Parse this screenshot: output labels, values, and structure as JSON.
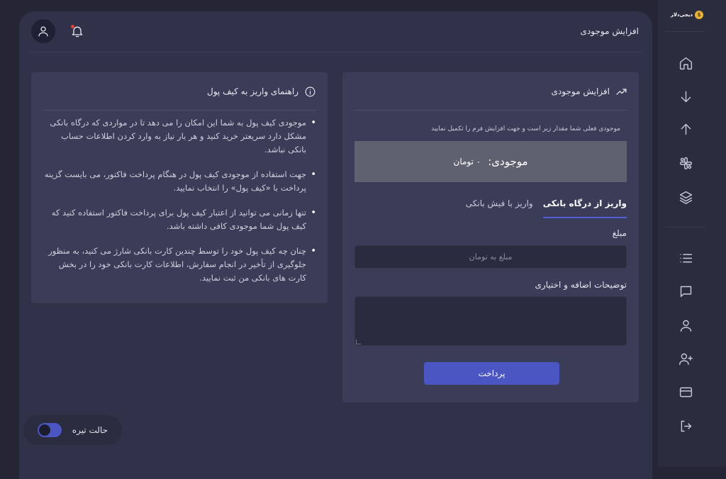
{
  "brand": {
    "name": "دیجی‌دلار",
    "logo_glyph": "$"
  },
  "topbar": {
    "title": "افزایش موجودی",
    "profile_icon": "user-icon",
    "notification_icon": "bell-icon"
  },
  "sidebar": {
    "items": [
      {
        "icon": "home-icon"
      },
      {
        "icon": "arrow-down-icon"
      },
      {
        "icon": "arrow-up-icon"
      },
      {
        "icon": "grid-icon"
      },
      {
        "icon": "layers-icon"
      },
      {
        "icon": "list-icon"
      },
      {
        "icon": "message-icon"
      },
      {
        "icon": "user-icon"
      },
      {
        "icon": "user-plus-icon"
      },
      {
        "icon": "credit-card-icon"
      },
      {
        "icon": "logout-icon"
      }
    ]
  },
  "guide": {
    "title": "راهنمای واریز به کیف پول",
    "icon": "info-icon",
    "items": [
      "موجودی کیف پول به شما این امکان را می دهد تا در مواردی که درگاه بانکی مشکل دارد سریعتر خرید کنید و هر بار نیاز به وارد کردن اطلاعات حساب بانکی نباشد.",
      "جهت استفاده از موجودی کیف پول در هنگام پرداخت فاکتور، می بایست گزینه پرداخت با «کیف پول» را انتخاب نمایید.",
      "تنها زمانی می توانید از اعتبار کیف پول برای پرداخت فاکتور استفاده کنید که کیف پول شما موجودی کافی داشته باشد.",
      "چنان چه کیف پول خود را توسط چندین کارت بانکی شارژ می کنید، به منظور جلوگیری از تأخیر در انجام سفارش، اطلاعات کارت بانکی خود را در بخش کارت های بانکی من ثبت نمایید."
    ]
  },
  "form": {
    "title": "افزایش موجودی",
    "icon": "trending-up-icon",
    "hint": "موجودی فعلی شما مقدار زیر است و جهت افزایش فرم را تکمیل نمایید",
    "balance_label": "موجودی:",
    "balance_value": "۰ تومان",
    "tabs": [
      {
        "label": "واریز از درگاه بانکی",
        "active": true
      },
      {
        "label": "واریز با فیش بانکی",
        "active": false
      }
    ],
    "amount_label": "مبلغ",
    "amount_value": "",
    "amount_placeholder": "مبلغ به تومان",
    "description_label": "توضیحات اضافه و اختیاری",
    "description_value": "",
    "submit_label": "پرداخت"
  },
  "dark_mode": {
    "label": "حالت تیره",
    "enabled": true
  },
  "colors": {
    "accent": "#4b56c2",
    "background": "#252536",
    "panel": "#30324a",
    "card": "#3b3d58",
    "notification_dot": "#e0433a"
  }
}
